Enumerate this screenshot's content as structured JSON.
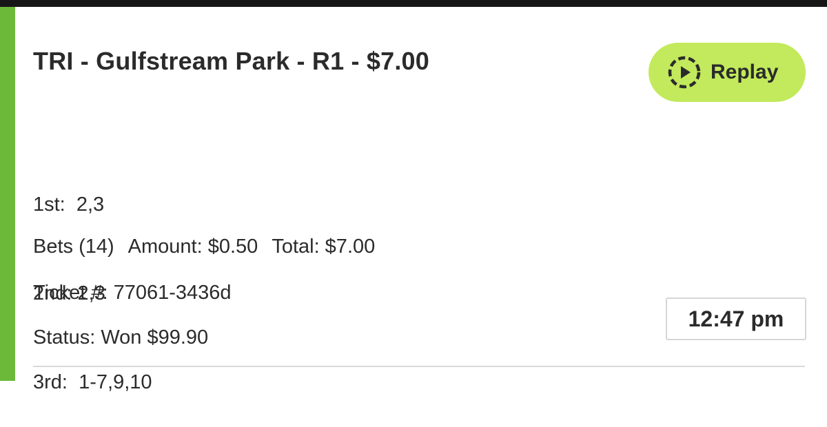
{
  "ticket": {
    "title": "TRI - Gulfstream Park - R1 - $7.00",
    "selections": [
      {
        "label": "1st:",
        "horses": "2,3"
      },
      {
        "label": "2nd:",
        "horses": "2,3"
      },
      {
        "label": "3rd:",
        "horses": "1-7,9,10"
      }
    ],
    "bets": "Bets (14)",
    "amount": "Amount: $0.50",
    "total": "Total: $7.00",
    "ticket_number": "Ticket #: 77061-3436d",
    "status": "Status: Won $99.90",
    "time": "12:47 pm"
  },
  "replay_button": {
    "label": "Replay",
    "icon": "replay-icon"
  },
  "colors": {
    "accent_stripe": "#6cb93a",
    "replay_button_bg": "#c2ea5c",
    "top_bar": "#161616",
    "text": "#2b2b2b"
  }
}
